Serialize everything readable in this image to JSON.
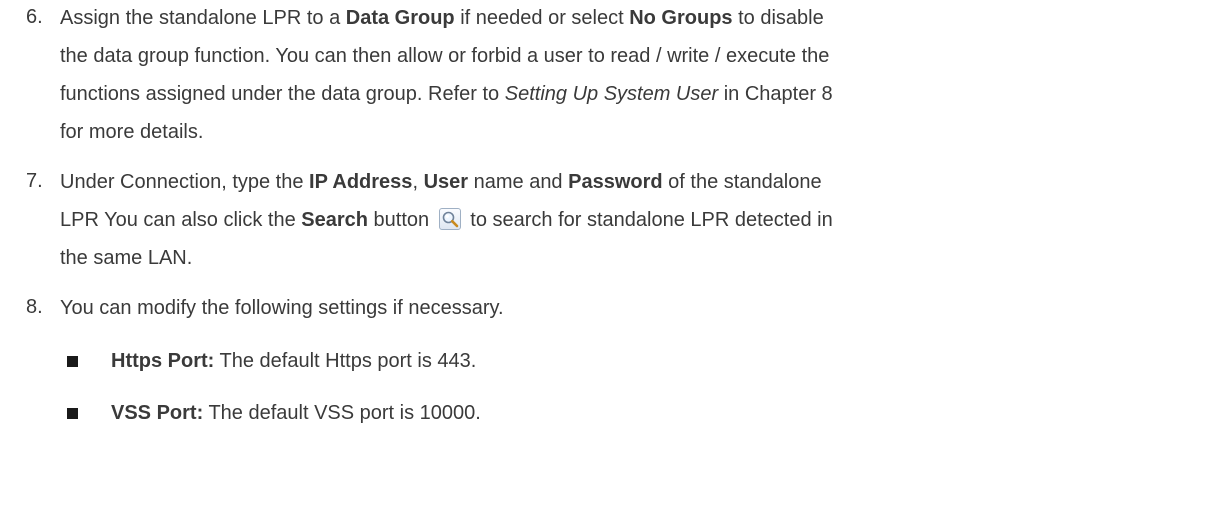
{
  "steps": {
    "s6": {
      "num": "6.",
      "l1_a": "Assign the standalone LPR to a ",
      "l1_b": "Data Group",
      "l1_c": " if needed or select ",
      "l1_d": "No Groups",
      "l1_e": " to disable",
      "l2": "the data group function. You can then allow or forbid a user to read / write / execute the",
      "l3_a": "functions assigned under the data group. Refer to ",
      "l3_b": "Setting Up System User",
      "l3_c": " in Chapter 8",
      "l4": "for more details."
    },
    "s7": {
      "num": "7.",
      "l1_a": "Under Connection, type the ",
      "l1_b": "IP Address",
      "l1_c": ", ",
      "l1_d": "User",
      "l1_e": " name and ",
      "l1_f": "Password",
      "l1_g": " of the standalone",
      "l2_a": "LPR You can also click the ",
      "l2_b": "Search",
      "l2_c": " button",
      "l2_d": "to search for standalone LPR detected in",
      "l3": "the same LAN."
    },
    "s8": {
      "num": "8.",
      "l1": "You can modify the following settings if necessary."
    }
  },
  "bullets": [
    {
      "label": "Https Port:",
      "text": " The default Https port is 443."
    },
    {
      "label": "VSS Port:",
      "text": " The default VSS port is 10000."
    }
  ],
  "icons": {
    "search_button": "magnifier-icon"
  }
}
